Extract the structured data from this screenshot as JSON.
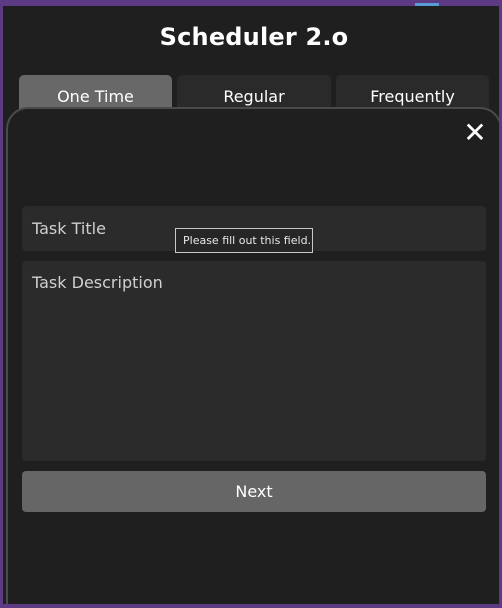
{
  "app": {
    "title": "Scheduler 2.o"
  },
  "tabs": [
    {
      "label": "One Time",
      "active": true
    },
    {
      "label": "Regular",
      "active": false
    },
    {
      "label": "Frequently",
      "active": false
    }
  ],
  "form": {
    "task_title_placeholder": "Task Title",
    "task_description_placeholder": "Task Description",
    "next_label": "Next"
  },
  "tooltip": {
    "message": "Please fill out this field."
  },
  "close_glyph": "✕",
  "colors": {
    "window_border": "#5d3a84",
    "background": "#1f1f1f",
    "field_background": "#2b2b2b",
    "active_tab": "#686868",
    "inactive_tab": "#2a2a2a",
    "next_button": "#666666"
  }
}
